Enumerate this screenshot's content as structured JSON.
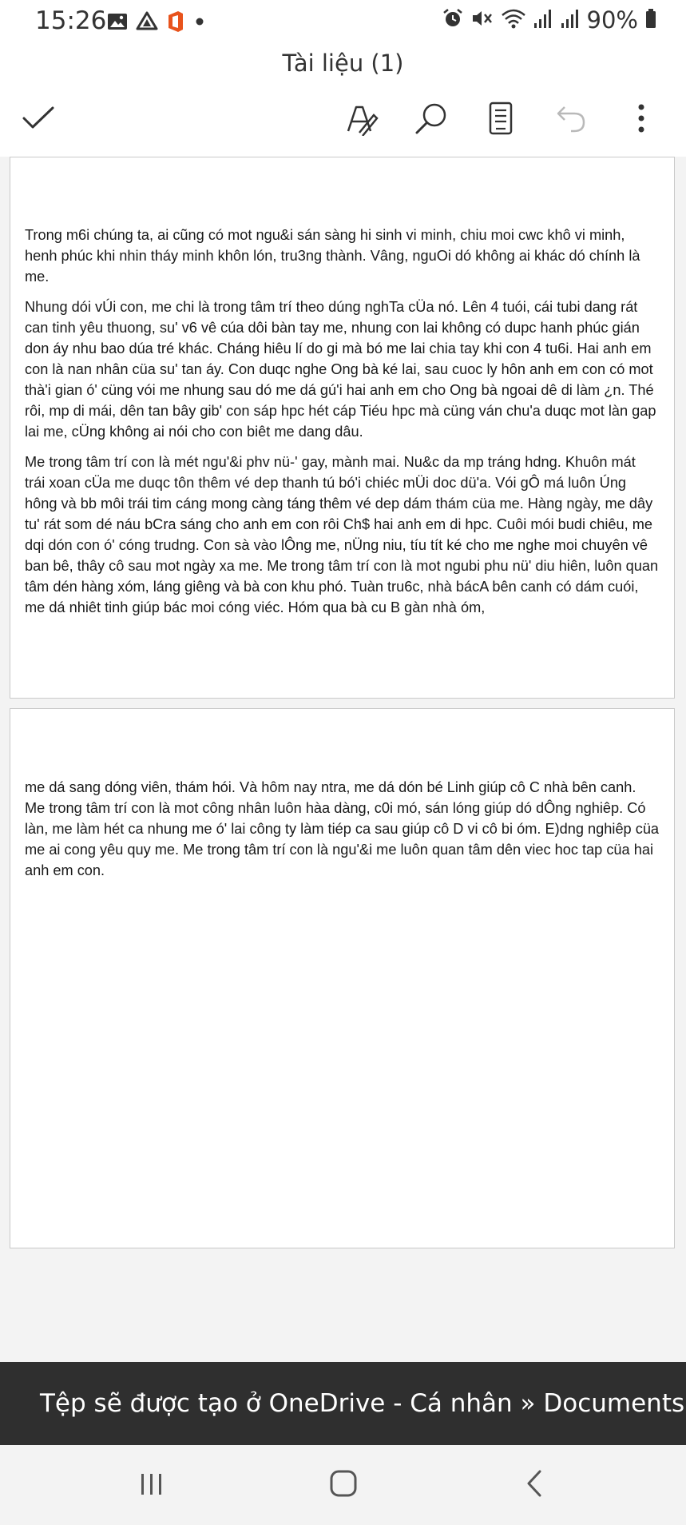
{
  "status_bar": {
    "time": "15:26",
    "battery": "90%",
    "left_icons": [
      "gallery-icon",
      "drive-icon",
      "office-icon",
      "dot-icon"
    ],
    "right_icons": [
      "alarm-icon",
      "mute-icon",
      "wifi-icon",
      "signal-icon",
      "signal-icon",
      "battery-icon"
    ]
  },
  "header": {
    "title": "Tài liệu (1)"
  },
  "toolbar": {
    "icons": [
      "check-icon",
      "draw-pen-icon",
      "search-icon",
      "reading-view-icon",
      "undo-icon",
      "more-vertical-icon"
    ]
  },
  "document": {
    "page1": [
      "Trong m6i chúng ta, ai cũng có mot ngu&i sán sàng hi sinh vi minh, chiu moi cwc khô vi minh, henh phúc khi nhin tháy minh khôn lón, tru3ng thành. Vâng, nguOi dó không ai khác dó chính là me.",
      "Nhung dói vÚi con, me chi là trong tâm trí theo dúng nghTa cÜa nó. Lên 4 tuói, cái tubi dang rát can tinh yêu thuong, su' v6 vê cúa dôi bàn tay me, nhung con lai không có dupc hanh phúc gián don áy nhu bao dúa tré khác. Cháng hiêu lí do gi mà bó me lai chia tay khi con   4 tu6i. Hai anh em con là nan nhân cüa su' tan        áy. Con duqc nghe Ong bà ké lai, sau cuoc ly hôn anh em con có mot thà'i gian ó' cüng vói me nhung sau dó me dá gú'i hai anh em cho Ong bà ngoai dê di làm ¿n. Thé rôi, mp di mái, dên tan bây gib' con sáp hpc hét cáp Tiéu hpc mà cüng ván chu'a duqc mot làn gap lai me, cÜng không ai nói cho con biêt me dang dâu.",
      "Me trong tâm trí con là mét ngu'&i phv nü-' gay, mành mai. Nu&c da mp tráng hdng. Khuôn mát trái xoan cÜa me duqc tôn thêm vé dep thanh tú bó'i chiéc mÜi doc dü'a. Vói gÔ má luôn Úng hông và bb môi trái tim cáng mong càng táng thêm vé dep dám thám cüa me. Hàng ngày, me dây tu' rát som dé náu bCra sáng cho anh em con rôi Ch$ hai anh em di hpc. Cuôi mói budi chiêu, me dqi dón con ó' cóng trudng. Con sà vào lÔng me, nÜng niu, tíu tít ké cho me nghe moi chuyên vê ban bê, thây cô sau mot ngày xa me. Me trong tâm trí con là mot ngubi phu nü' diu hiên, luôn quan tâm dén hàng xóm, láng giêng và bà con khu phó. Tuàn tru6c, nhà bácA bên canh có dám cuói, me dá nhiêt tinh giúp bác moi cóng viéc. Hóm qua bà cu B gàn nhà óm,"
    ],
    "page2": [
      "me dá sang dóng viên, thám hói. Và hôm nay ntra, me dá dón bé Linh giúp cô C nhà bên canh. Me trong tâm trí con là mot công nhân luôn hàa dàng, c0i mó, sán lóng giúp dó dÔng nghiêp. Có làn, me làm hét ca nhung me ó' lai công ty làm tiép ca sau giúp cô D vi cô bi óm. E)dng nghiêp cüa me ai cong yêu quy me. Me trong tâm trí con là ngu'&i me luôn quan tâm dên viec hoc tap cüa hai anh em con."
    ]
  },
  "banner": {
    "text": "Tệp sẽ được tạo ở OneDrive - Cá nhân » Documents"
  },
  "nav_bar": {
    "icons": [
      "recent-apps-icon",
      "home-icon",
      "back-icon"
    ]
  },
  "colors": {
    "banner_bg": "#2f2f2f",
    "canvas_bg": "#f3f3f3",
    "disabled_icon": "#b9b9b9"
  }
}
